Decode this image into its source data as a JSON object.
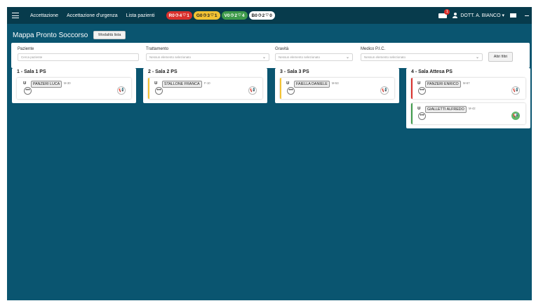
{
  "nav": {
    "links": [
      "Accettazione",
      "Accettazione d'urgenza",
      "Lista pazienti"
    ],
    "summary_pills": [
      {
        "label": "R",
        "a": "0",
        "b": "4",
        "c": "1",
        "bg": "#d9302c",
        "fg": "#ffffff"
      },
      {
        "label": "G",
        "a": "0",
        "b": "3",
        "c": "1",
        "bg": "#f2c233",
        "fg": "#222222"
      },
      {
        "label": "V",
        "a": "0",
        "b": "2",
        "c": "4",
        "bg": "#3e9a4a",
        "fg": "#ffffff"
      },
      {
        "label": "B",
        "a": "0",
        "b": "2",
        "c": "0",
        "bg": "#ffffff",
        "fg": "#222222"
      }
    ],
    "ambulance_badge": "1",
    "user": "DOTT. A. BIANCO ▾"
  },
  "page": {
    "title": "Mappa Pronto Soccorso",
    "mode_button": "Modalità lista"
  },
  "filters": {
    "paziente": {
      "label": "Paziente",
      "placeholder": "Cerca paziente"
    },
    "trattamento": {
      "label": "Trattamento",
      "value": "Nessun elemento selezionato"
    },
    "gravita": {
      "label": "Gravità",
      "value": "Nessun elemento selezionato"
    },
    "medico": {
      "label": "Medico P.I.C.",
      "value": "Nessun elemento selezionato"
    },
    "altri_filtri": "Altri filtri"
  },
  "rooms": [
    {
      "title": "1 - Sala 1 PS",
      "patients": [
        {
          "name": "PANZERI LUCA",
          "code": "M-30",
          "color": "#ffffff",
          "action": "📢",
          "ok": false
        }
      ]
    },
    {
      "title": "2 - Sala 2 PS",
      "patients": [
        {
          "name": "STALLONE FRANCA",
          "code": "F-10",
          "color": "#f2c233",
          "action": "📢",
          "ok": false
        }
      ]
    },
    {
      "title": "3 - Sala 3 PS",
      "patients": [
        {
          "name": "FAIELLA DANIELE",
          "code": "M-53",
          "color": "#f2c233",
          "action": "📢",
          "ok": false
        }
      ]
    },
    {
      "title": "4 - Sala Attesa PS",
      "patients": [
        {
          "name": "PANZERI ENRICO",
          "code": "M-67",
          "color": "#d9302c",
          "action": "📢",
          "ok": false
        },
        {
          "name": "GIALLETTI ALFREDO",
          "code": "M-42",
          "color": "#3e9a4a",
          "action": "📢",
          "ok": true
        }
      ]
    }
  ],
  "icons": {
    "more": "•••",
    "stethoscope": "ʊ"
  }
}
